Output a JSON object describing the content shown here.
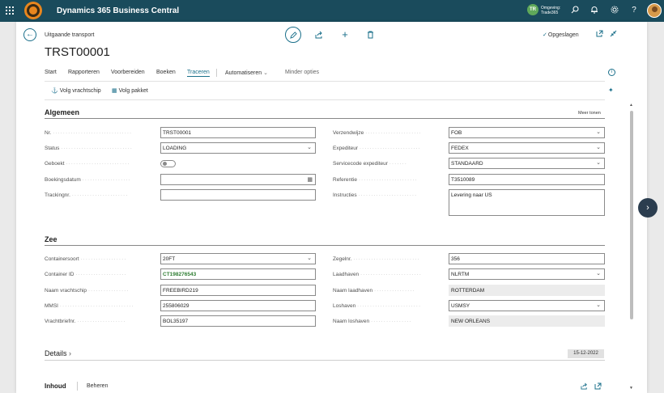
{
  "topbar": {
    "app_title": "Dynamics 365 Business Central",
    "env_badge": "TR",
    "env_line1": "Omgeving:",
    "env_line2": "Trade365",
    "icons": [
      "waffle-icon",
      "search-icon",
      "bell-icon",
      "gear-icon",
      "help-icon",
      "avatar"
    ]
  },
  "header": {
    "breadcrumb": "Uitgaande transport",
    "title": "TRST00001",
    "saved": "Opgeslagen"
  },
  "actionbar": {
    "items": [
      "Start",
      "Rapporteren",
      "Voorbereiden",
      "Boeken",
      "Traceren",
      "Automatiseren",
      "Minder opties"
    ],
    "active": "Traceren"
  },
  "subactions": {
    "track_ship": "Volg vrachtschip",
    "track_package": "Volg pakket"
  },
  "general": {
    "title": "Algemeen",
    "more": "Meer tonen",
    "nr_label": "Nr.",
    "nr_value": "TRST00001",
    "status_label": "Status",
    "status_value": "LOADING",
    "booked_label": "Geboekt",
    "booked_value": false,
    "booking_date_label": "Boekingsdatum",
    "booking_date_value": "",
    "tracking_label": "Trackingnr.",
    "tracking_value": "",
    "shipping_method_label": "Verzendwijze",
    "shipping_method_value": "FOB",
    "carrier_label": "Expediteur",
    "carrier_value": "FEDEX",
    "service_label": "Servicecode expediteur",
    "service_value": "STANDAARD",
    "reference_label": "Referentie",
    "reference_value": "T3510089",
    "instructions_label": "Instructies",
    "instructions_value": "Levering naar US"
  },
  "sea": {
    "title": "Zee",
    "container_type_label": "Containersoort",
    "container_type_value": "20FT",
    "container_id_label": "Container ID",
    "container_id_value": "CT198276543",
    "ship_name_label": "Naam vrachtschip",
    "ship_name_value": "FREEBIRD219",
    "mmsi_label": "MMSI",
    "mmsi_value": "255806029",
    "bol_label": "Vrachtbriefnr.",
    "bol_value": "BOL35197",
    "seal_label": "Zegelnr.",
    "seal_value": "356",
    "load_port_label": "Laadhaven",
    "load_port_value": "NLRTM",
    "load_port_name_label": "Naam laadhaven",
    "load_port_name_value": "ROTTERDAM",
    "discharge_port_label": "Loshaven",
    "discharge_port_value": "USMSY",
    "discharge_port_name_label": "Naam loshaven",
    "discharge_port_name_value": "NEW ORLEANS"
  },
  "details": {
    "title": "Details",
    "date": "15-12-2022"
  },
  "lines": {
    "title": "Inhoud",
    "manage": "Beheren"
  },
  "colors": {
    "topbar": "#1a4b5c",
    "accent": "#1a6f8a",
    "container_id": "#2e7d32"
  }
}
